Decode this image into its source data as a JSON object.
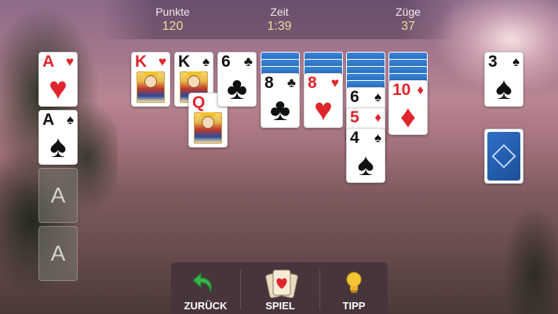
{
  "header": {
    "score_label": "Punkte",
    "score_value": "120",
    "time_label": "Zeit",
    "time_value": "1:39",
    "moves_label": "Züge",
    "moves_value": "37"
  },
  "foundations": [
    {
      "state": "card",
      "rank": "A",
      "suit": "♥",
      "color": "red"
    },
    {
      "state": "card",
      "rank": "A",
      "suit": "♠",
      "color": "black"
    },
    {
      "state": "empty",
      "placeholder": "A"
    },
    {
      "state": "empty",
      "placeholder": "A"
    }
  ],
  "tableau": [
    {
      "facedown": 0,
      "cards": [
        {
          "rank": "K",
          "suit": "♥",
          "color": "red",
          "court": true
        }
      ]
    },
    {
      "facedown": 0,
      "cards": [
        {
          "rank": "K",
          "suit": "♠",
          "color": "black",
          "court": true
        },
        {
          "rank": "Q",
          "suit": "♦",
          "color": "red",
          "court": true
        }
      ]
    },
    {
      "facedown": 0,
      "cards": [
        {
          "rank": "6",
          "suit": "♣",
          "color": "black"
        }
      ]
    },
    {
      "facedown": 3,
      "cards": [
        {
          "rank": "8",
          "suit": "♣",
          "color": "black"
        }
      ]
    },
    {
      "facedown": 3,
      "cards": [
        {
          "rank": "8",
          "suit": "♥",
          "color": "red"
        }
      ]
    },
    {
      "facedown": 5,
      "cards": [
        {
          "rank": "6",
          "suit": "♠",
          "color": "black"
        },
        {
          "rank": "5",
          "suit": "♦",
          "color": "red"
        },
        {
          "rank": "4",
          "suit": "♠",
          "color": "black"
        }
      ]
    },
    {
      "facedown": 4,
      "cards": [
        {
          "rank": "10",
          "suit": "♦",
          "color": "red"
        }
      ]
    }
  ],
  "waste": {
    "rank": "3",
    "suit": "♠",
    "color": "black"
  },
  "stock": {
    "icon": "card-back-icon"
  },
  "toolbar": {
    "undo_label": "ZURÜCK",
    "undo_icon": "undo-arrow-icon",
    "game_label": "SPIEL",
    "game_icon": "cards-heart-icon",
    "hint_label": "TIPP",
    "hint_icon": "lightbulb-icon"
  },
  "colors": {
    "accent_score": "#f0dca0",
    "card_red": "#e0242c",
    "card_back": "#2f6fc8",
    "undo_green": "#3bb54a",
    "hint_yellow": "#f4c534"
  }
}
